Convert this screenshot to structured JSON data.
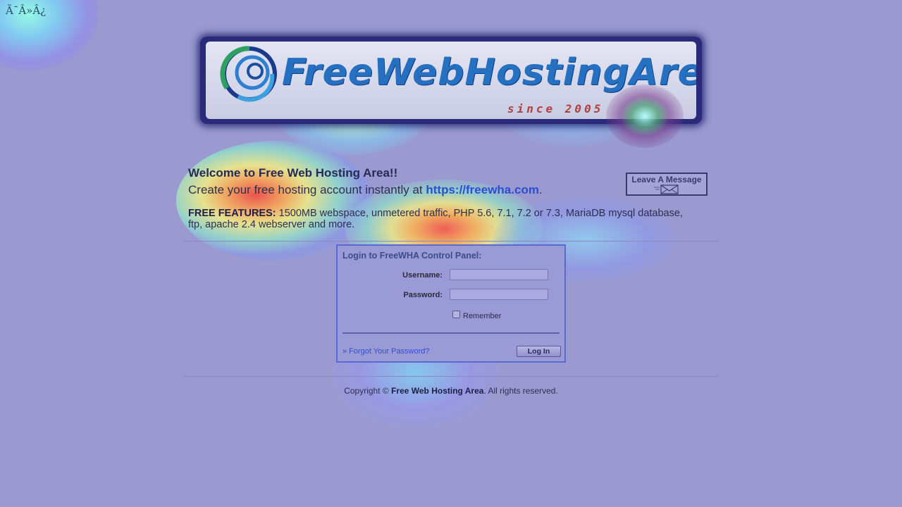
{
  "encoding_glyphs": "Ã¯Â»Â¿",
  "banner": {
    "logo_text": "FreeWebHostingArea",
    "tagline": "since 2005"
  },
  "intro": {
    "welcome": "Welcome to Free Web Hosting Area!!",
    "create_prefix": "Create your free hosting account instantly at ",
    "create_link": "https://freewha.com",
    "create_suffix": ".",
    "features_label": "FREE FEATURES:",
    "features_text": " 1500MB webspace, unmetered traffic, PHP 5.6, 7.1, 7.2 or 7.3, MariaDB mysql database, ftp, apache 2.4 webserver and more."
  },
  "message_button": {
    "label": "Leave A Message",
    "icon": "envelope-icon"
  },
  "login": {
    "title": "Login to FreeWHA Control Panel:",
    "username_label": "Username:",
    "username_value": "",
    "password_label": "Password:",
    "password_value": "",
    "remember_label": "Remember",
    "remember_checked": false,
    "forgot_link": "» Forgot Your Password?",
    "submit_label": "Log In"
  },
  "footer": {
    "copyright_prefix": "Copyright © ",
    "site_name": "Free Web Hosting Area",
    "copyright_suffix": ". All rights reserved."
  },
  "colors": {
    "page_background": "#9a9ad0",
    "link": "#2b4fd0",
    "banner_border": "#2a2a7a",
    "logo_text": "#2570c0",
    "tagline": "#b04040"
  }
}
